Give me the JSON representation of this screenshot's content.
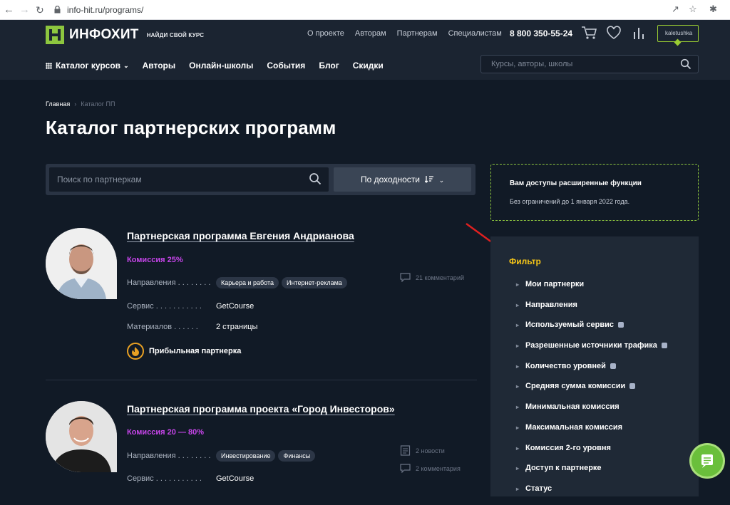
{
  "browser": {
    "url": "info-hit.ru/programs/"
  },
  "header": {
    "logo_name": "ИНФОХИТ",
    "logo_tagline": "НАЙДИ СВОЙ КУРС",
    "top_links": [
      "О проекте",
      "Авторам",
      "Партнерам",
      "Специалистам"
    ],
    "phone": "8 800 350-55-24",
    "user": "kaletushka",
    "menu": [
      "Каталог курсов",
      "Авторы",
      "Онлайн-школы",
      "События",
      "Блог",
      "Скидки"
    ],
    "search_placeholder": "Курсы, авторы, школы"
  },
  "breadcrumb": {
    "home": "Главная",
    "current": "Каталог ПП"
  },
  "page_title": "Каталог партнерских программ",
  "filters": {
    "search_placeholder": "Поиск по партнеркам",
    "sort_label": "По доходности"
  },
  "promo": {
    "title": "Вам доступы расширенные функции",
    "subtitle": "Без ограничений до 1 января 2022 года."
  },
  "programs": [
    {
      "title": "Партнерская программа Евгения Андрианова",
      "commission": "Комиссия 25%",
      "directions_label": "Направления . . . . . . . .",
      "directions": [
        "Карьера и работа",
        "Интернет-реклама"
      ],
      "service_label": "Сервис . . . . . . . . . . .",
      "service": "GetCourse",
      "materials_label": "Материалов . . . . . .",
      "materials": "2 страницы",
      "comments": "21 комментарий",
      "badge": "Прибыльная партнерка"
    },
    {
      "title": "Партнерская программа проекта «Город Инвесторов»",
      "commission": "Комиссия 20 — 80%",
      "directions_label": "Направления . . . . . . . .",
      "directions": [
        "Инвестирование",
        "Финансы"
      ],
      "service_label": "Сервис . . . . . . . . . . .",
      "service": "GetCourse",
      "news": "2 новости",
      "comments": "2 комментария"
    }
  ],
  "sidebar": {
    "title": "Фильтр",
    "items": [
      {
        "label": "Мои партнерки",
        "help": false
      },
      {
        "label": "Направления",
        "help": false
      },
      {
        "label": "Используемый сервис",
        "help": true
      },
      {
        "label": "Разрешенные источники трафика",
        "help": true
      },
      {
        "label": "Количество уровней",
        "help": true
      },
      {
        "label": "Средняя сумма комиссии",
        "help": true
      },
      {
        "label": "Минимальная комиссия",
        "help": false
      },
      {
        "label": "Максимальная комиссия",
        "help": false
      },
      {
        "label": "Комиссия 2-го уровня",
        "help": false
      },
      {
        "label": "Доступ к партнерке",
        "help": false
      },
      {
        "label": "Статус",
        "help": false
      }
    ]
  },
  "colors": {
    "accent": "#8dc63f",
    "commission": "#c745ea",
    "filter_title": "#f5c518",
    "bg": "#111a26"
  }
}
